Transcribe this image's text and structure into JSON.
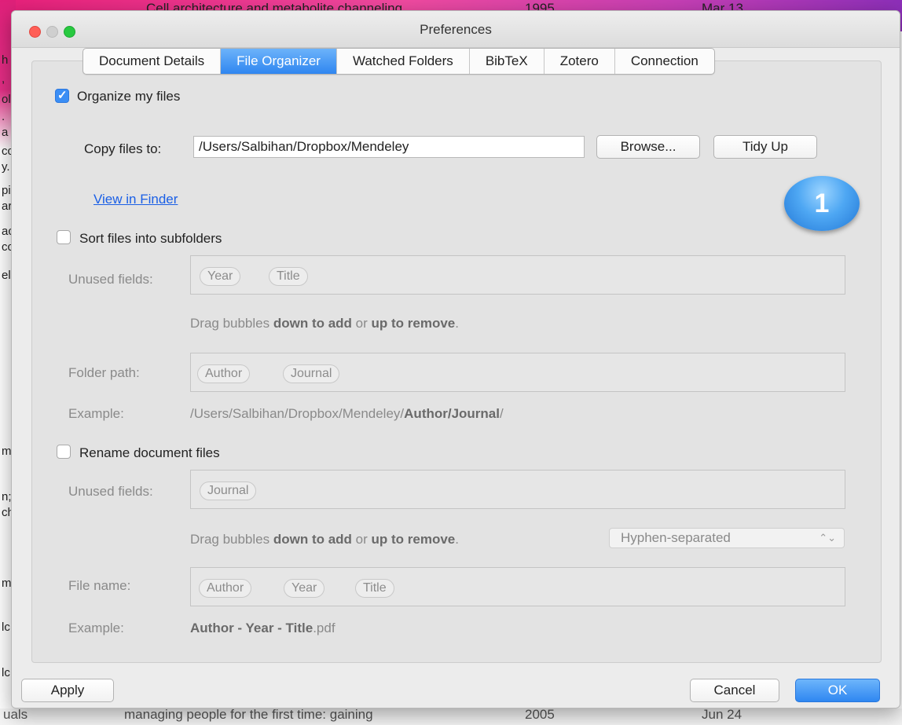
{
  "background": {
    "top_row": {
      "title": "Cell architecture and metabolite channeling",
      "year": "1995",
      "date": "Mar 13"
    },
    "bottom_row": {
      "title": "managing people for the first time: gaining",
      "year": "2005",
      "date": "Jun 24"
    },
    "left_fragments": [
      "h",
      ",",
      "ol",
      ".",
      "a",
      "cc",
      "y.",
      "pi",
      "ar",
      "ac",
      "cc",
      "el",
      "m",
      "n;",
      "ch",
      "m",
      "lc",
      "lc",
      "uals"
    ]
  },
  "window": {
    "title": "Preferences"
  },
  "tabs": [
    {
      "label": "Document Details",
      "active": false
    },
    {
      "label": "File Organizer",
      "active": true
    },
    {
      "label": "Watched Folders",
      "active": false
    },
    {
      "label": "BibTeX",
      "active": false
    },
    {
      "label": "Zotero",
      "active": false
    },
    {
      "label": "Connection",
      "active": false
    }
  ],
  "organize": {
    "label": "Organize my files",
    "checked": true
  },
  "copy": {
    "label": "Copy files to:",
    "path": "/Users/Salbihan/Dropbox/Mendeley",
    "browse": "Browse...",
    "tidy": "Tidy Up",
    "view_in_finder": "View in Finder"
  },
  "sort": {
    "label": "Sort files into subfolders",
    "checked": false,
    "unused_label": "Unused fields:",
    "unused_bubbles": [
      "Year",
      "Title"
    ],
    "hint_a": "Drag bubbles ",
    "hint_b": "down to add",
    "hint_c": " or ",
    "hint_d": "up to remove",
    "hint_e": ".",
    "folder_label": "Folder path:",
    "folder_bubbles": [
      "Author",
      "Journal"
    ],
    "example_label": "Example:",
    "example_prefix": "/Users/Salbihan/Dropbox/Mendeley/",
    "example_bold": "Author/Journal",
    "example_suffix": "/"
  },
  "rename": {
    "label": "Rename document files",
    "checked": false,
    "unused_label": "Unused fields:",
    "unused_bubbles": [
      "Journal"
    ],
    "hint_a": "Drag bubbles ",
    "hint_b": "down to add",
    "hint_c": " or ",
    "hint_d": "up to remove",
    "hint_e": ".",
    "separator": "Hyphen-separated",
    "filename_label": "File name:",
    "filename_bubbles": [
      "Author",
      "Year",
      "Title"
    ],
    "example_label": "Example:",
    "example_bold": "Author - Year - Title",
    "example_suffix": ".pdf"
  },
  "footer": {
    "apply": "Apply",
    "cancel": "Cancel",
    "ok": "OK"
  },
  "callout": {
    "number": "1"
  },
  "colors": {
    "accent": "#2f87f1",
    "link": "#1a5fe6",
    "banner": "#e8207a"
  }
}
